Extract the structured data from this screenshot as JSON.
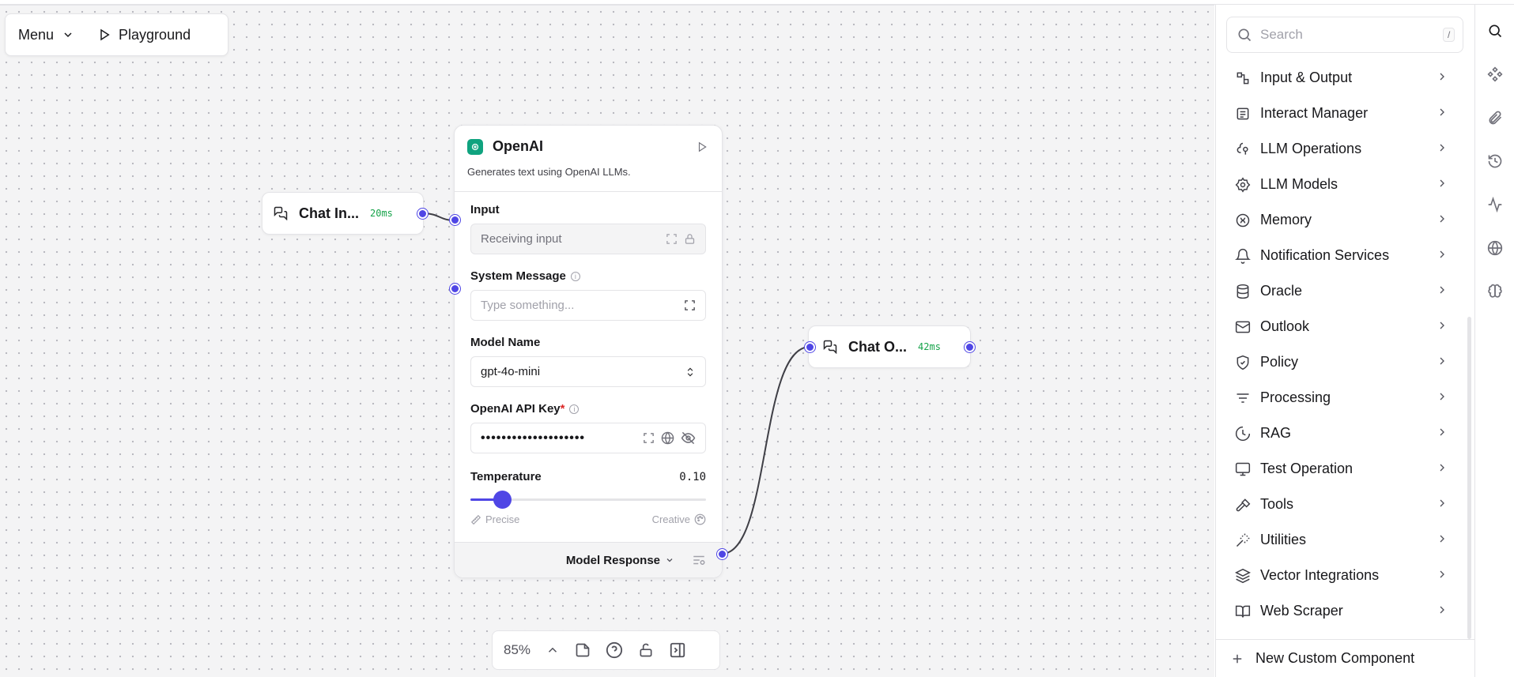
{
  "topbar": {
    "menu_label": "Menu",
    "playground_label": "Playground"
  },
  "chat_input_node": {
    "label": "Chat In...",
    "time": "20ms"
  },
  "chat_output_node": {
    "label": "Chat O...",
    "time": "42ms"
  },
  "openai_node": {
    "title": "OpenAI",
    "description": "Generates text using OpenAI LLMs.",
    "input_label": "Input",
    "input_value": "Receiving input",
    "system_message_label": "System Message",
    "system_message_placeholder": "Type something...",
    "model_name_label": "Model Name",
    "model_name_value": "gpt-4o-mini",
    "api_key_label": "OpenAI API Key",
    "api_key_required": "*",
    "api_key_value": "••••••••••••••••••••",
    "temperature_label": "Temperature",
    "temperature_value": "0.10",
    "temperature_fraction": 0.1,
    "precise_label": "Precise",
    "creative_label": "Creative",
    "output_label": "Model Response"
  },
  "zoombar": {
    "zoom": "85%"
  },
  "panel": {
    "search_placeholder": "Search",
    "search_shortcut": "/",
    "categories": [
      {
        "label": "Input & Output",
        "icon": "input-output-icon"
      },
      {
        "label": "Interact Manager",
        "icon": "interact-manager-icon"
      },
      {
        "label": "LLM Operations",
        "icon": "llm-operations-icon"
      },
      {
        "label": "LLM Models",
        "icon": "llm-models-icon"
      },
      {
        "label": "Memory",
        "icon": "memory-icon"
      },
      {
        "label": "Notification Services",
        "icon": "bell-icon"
      },
      {
        "label": "Oracle",
        "icon": "database-icon"
      },
      {
        "label": "Outlook",
        "icon": "mail-icon"
      },
      {
        "label": "Policy",
        "icon": "shield-icon"
      },
      {
        "label": "Processing",
        "icon": "filter-icon"
      },
      {
        "label": "RAG",
        "icon": "rag-icon"
      },
      {
        "label": "Test Operation",
        "icon": "monitor-icon"
      },
      {
        "label": "Tools",
        "icon": "hammer-icon"
      },
      {
        "label": "Utilities",
        "icon": "wand-icon"
      },
      {
        "label": "Vector Integrations",
        "icon": "layers-icon"
      },
      {
        "label": "Web Scraper",
        "icon": "book-icon"
      }
    ],
    "new_component_label": "New Custom Component"
  },
  "colors": {
    "accent": "#4f46e5",
    "openai": "#10a37f",
    "ms_green": "#16a34a"
  }
}
